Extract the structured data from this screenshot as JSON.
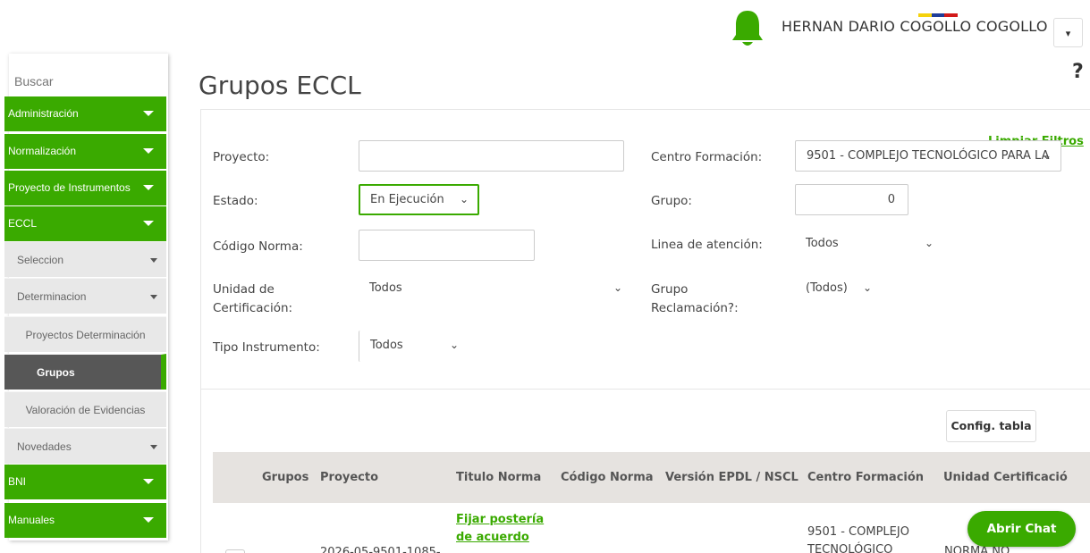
{
  "header": {
    "user_name": "HERNAN DARIO COGOLLO COGOLLO",
    "dropdown_glyph": "▾",
    "help_glyph": "?",
    "bell_icon": "bell-icon",
    "flag_colors": [
      "#f5d20c",
      "#1f3d99",
      "#d21a1a"
    ]
  },
  "sidebar": {
    "search_placeholder": "Buscar",
    "items": [
      {
        "label": "Administración"
      },
      {
        "label": "Normalización"
      },
      {
        "label": "Proyecto de Instrumentos"
      },
      {
        "label": "ECCL"
      },
      {
        "label": "Seleccion"
      },
      {
        "label": "Determinacion"
      },
      {
        "label": "Proyectos Determinación"
      },
      {
        "label": "Grupos"
      },
      {
        "label": "Valoración de Evidencias"
      },
      {
        "label": "Novedades"
      },
      {
        "label": "BNI"
      },
      {
        "label": "Manuales"
      }
    ]
  },
  "main": {
    "title": "Grupos ECCL",
    "clear_filters": "Limpiar Filtros",
    "filters": {
      "proyecto": {
        "label": "Proyecto:",
        "value": ""
      },
      "estado": {
        "label": "Estado:",
        "value": "En Ejecución"
      },
      "codigo_norma": {
        "label": "Código Norma:",
        "value": ""
      },
      "unidad_line1": "Unidad de",
      "unidad_line2": "Certificación:",
      "unidad_value": "Todos",
      "tipo_instrumento": {
        "label": "Tipo Instrumento:",
        "value": "Todos"
      },
      "centro_formacion": {
        "label": "Centro Formación:",
        "value": "9501 - COMPLEJO TECNOLÓGICO PARA LA"
      },
      "grupo": {
        "label": "Grupo:",
        "value": "0"
      },
      "linea_atencion": {
        "label": "Linea de atención:",
        "value": "Todos"
      },
      "reclamacion_line1": "Grupo",
      "reclamacion_line2": "Reclamación?:",
      "reclamacion_value": "(Todos)"
    },
    "config_button": "Config. tabla ▾",
    "table": {
      "columns": [
        "Grupos",
        "Proyecto",
        "Titulo Norma",
        "Código Norma",
        "Versión EPDL / NSCL",
        "Centro Formación",
        "Unidad Certificació"
      ],
      "row": {
        "titulo_line1": "Fijar postería",
        "titulo_line2": "de acuerdo",
        "proyecto": "2026-05-9501-1085-",
        "centro_line1": "9501 - COMPLEJO",
        "centro_line2": "TECNOLÓGICO",
        "unidad": "NORMA NO"
      }
    }
  },
  "chat": {
    "label": "Abrir Chat"
  },
  "colors": {
    "accent": "#3aaa00",
    "active_bg": "#575757",
    "table_head": "#e6e3e0"
  }
}
